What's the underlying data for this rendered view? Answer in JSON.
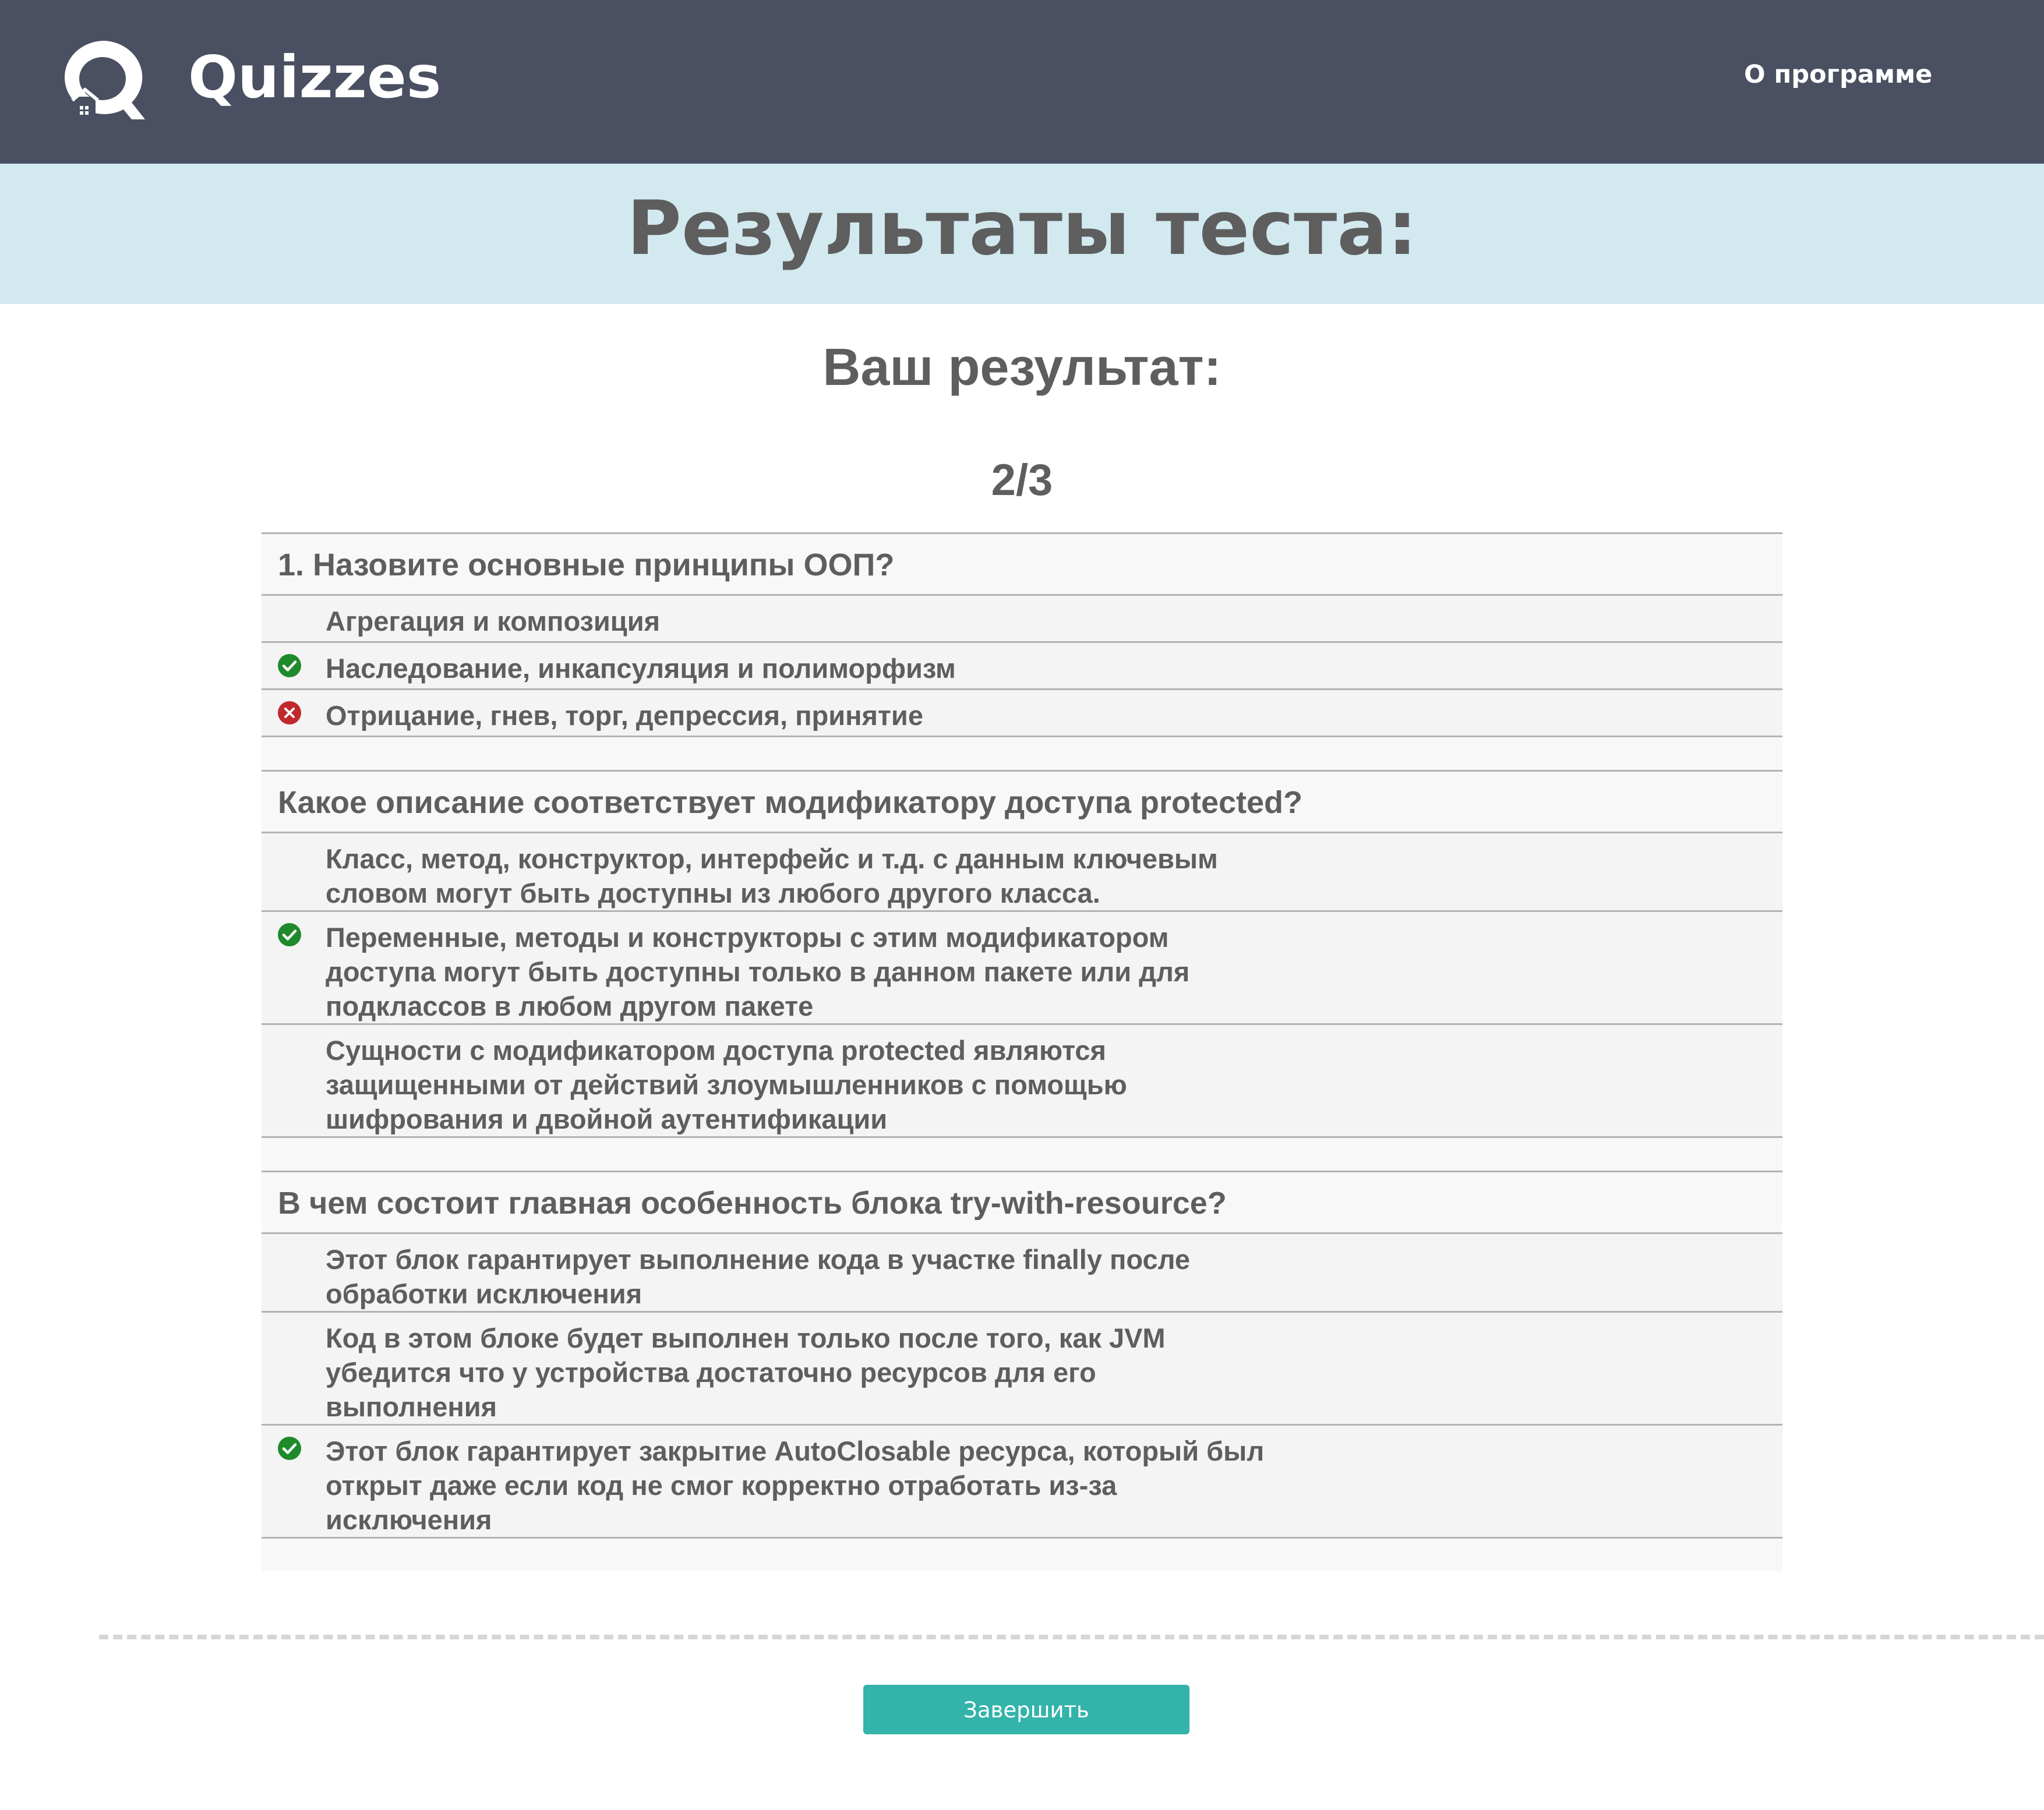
{
  "header": {
    "brand": "Quizzes",
    "about_link": "О программе",
    "logo_icon": "quizzes-q-logo-icon"
  },
  "page": {
    "title": "Результаты теста:",
    "result_heading": "Ваш результат:",
    "score": "2/3"
  },
  "colors": {
    "header_bg": "#4a5061",
    "title_band_bg": "#d2e9f0",
    "correct": "#1f8a2b",
    "wrong": "#c0282d",
    "button": "#33b3a9"
  },
  "questions": [
    {
      "title": "1. Назовите основные принципы ООП?",
      "answers": [
        {
          "text": "Агрегация и композиция",
          "status": "none"
        },
        {
          "text": "Наследование, инкапсуляция и полиморфизм",
          "status": "correct",
          "icon": "check-circle-icon"
        },
        {
          "text": "Отрицание, гнев, торг, депрессия, принятие",
          "status": "wrong",
          "icon": "cross-circle-icon"
        }
      ]
    },
    {
      "title": "Какое описание соответствует модификатору доступа protected?",
      "answers": [
        {
          "text": "Класс, метод, конструктор, интерфейс и т.д. с данным ключевым словом могут быть доступны из любого другого класса.",
          "status": "none"
        },
        {
          "text": "Переменные, методы и конструкторы с этим модификатором доступа могут быть доступны только в данном пакете или для подклассов в любом другом пакете",
          "status": "correct",
          "icon": "check-circle-icon"
        },
        {
          "text": "Сущности с модификатором доступа protected являются защищенными от действий злоумышленников с помощью шифрования и двойной аутентификации",
          "status": "none"
        }
      ]
    },
    {
      "title": "В чем состоит главная особенность блока try-with-resource?",
      "answers": [
        {
          "text": "Этот блок гарантирует выполнение кода в участке finally после обработки исключения",
          "status": "none"
        },
        {
          "text": "Код в этом блоке будет выполнен только после того, как JVM убедится что у устройства достаточно ресурсов для его выполнения",
          "status": "none"
        },
        {
          "text": "Этот блок гарантирует закрытие AutoClosable ресурса, который был открыт даже если код не смог корректно отработать из-за исключения",
          "status": "correct",
          "icon": "check-circle-icon"
        }
      ]
    }
  ],
  "actions": {
    "finish_label": "Завершить"
  }
}
